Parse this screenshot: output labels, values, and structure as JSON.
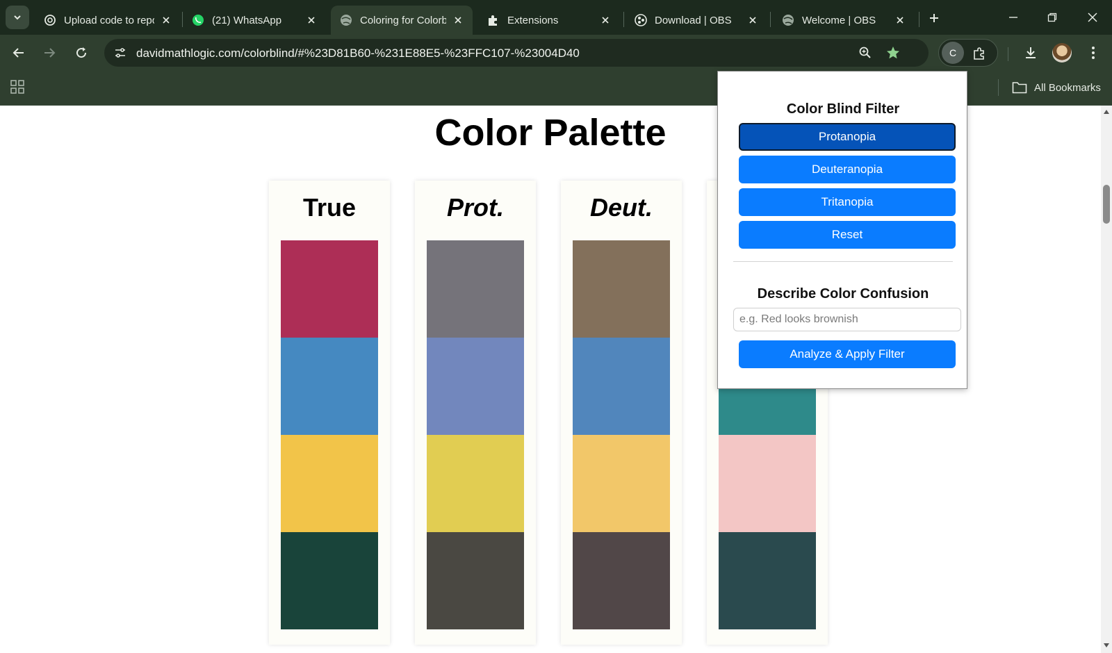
{
  "browser": {
    "tabs": [
      {
        "label": "Upload code to repository",
        "active": false,
        "icon": "openai-icon"
      },
      {
        "label": "(21) WhatsApp",
        "active": false,
        "icon": "whatsapp-icon"
      },
      {
        "label": "Coloring for Colorblindness",
        "active": true,
        "icon": "globe-icon"
      },
      {
        "label": "Extensions",
        "active": false,
        "icon": "puzzle-icon"
      },
      {
        "label": "Download | OBS",
        "active": false,
        "icon": "obs-icon"
      },
      {
        "label": "Welcome | OBS",
        "active": false,
        "icon": "globe-icon"
      }
    ],
    "url": "davidmathlogic.com/colorblind/#%23D81B60-%231E88E5-%23FFC107-%23004D40",
    "extension_badge": "C",
    "all_bookmarks_label": "All Bookmarks"
  },
  "page": {
    "title": "Color Palette",
    "columns": [
      {
        "title": "True",
        "italic": false,
        "swatches": [
          "#ad2e56",
          "#4589c1",
          "#f2c449",
          "#19443a"
        ]
      },
      {
        "title": "Prot.",
        "italic": true,
        "swatches": [
          "#75737a",
          "#7287bd",
          "#e1cd52",
          "#4a4842"
        ]
      },
      {
        "title": "Deut.",
        "italic": true,
        "swatches": [
          "#83705b",
          "#5186bc",
          "#f2c769",
          "#514748"
        ]
      },
      {
        "title": "",
        "italic": true,
        "swatches": [
          "#2e8a8a",
          "#2e8a8a",
          "#f3c6c5",
          "#2a4a4e"
        ]
      }
    ]
  },
  "popup": {
    "filter_heading": "Color Blind Filter",
    "buttons": [
      {
        "label": "Protanopia",
        "active": true
      },
      {
        "label": "Deuteranopia",
        "active": false
      },
      {
        "label": "Tritanopia",
        "active": false
      },
      {
        "label": "Reset",
        "active": false
      }
    ],
    "confusion_heading": "Describe Color Confusion",
    "input_placeholder": "e.g. Red looks brownish",
    "input_value": "",
    "analyze_label": "Analyze & Apply Filter"
  },
  "colors": {
    "chrome_dark": "#1c2a1e",
    "chrome": "#2f3f2f",
    "accent_button": "#0a7cff",
    "accent_button_active": "#0553b8"
  }
}
